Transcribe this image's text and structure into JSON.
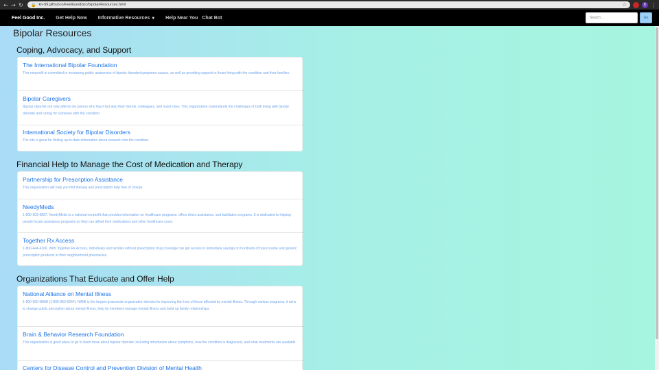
{
  "browser": {
    "back_icon": "back-arrow-icon",
    "forward_icon": "forward-arrow-icon",
    "reload_icon": "reload-icon",
    "url": "kn-99.github.io/FeelGood/src/bipolarResources.html"
  },
  "navbar": {
    "brand": "Feel Good Inc.",
    "links": [
      "Get Help Now",
      "Informative Resources",
      "Help Near You",
      "Chat Bot"
    ],
    "search_placeholder": "Search...",
    "search_button": "Go"
  },
  "page_title": "Bipolar Resources",
  "sections": [
    {
      "heading": "Coping, Advocacy, and Support",
      "items": [
        {
          "title": "The International Bipolar Foundation",
          "desc": "This nonprofit is committed to increasing public awareness of bipolar disorder/symptoms causes, as well as providing support to those living with the condition and their families."
        },
        {
          "title": "Bipolar Caregivers",
          "desc": "Bipolar disorder not only affects the person who has it but also their friends, colleagues, and loved ones. This organization understands the challenges of both living with bipolar disorder and caring for someone with the condition."
        },
        {
          "title": "International Society for Bipolar Disorders",
          "desc": "The site is great for finding up-to-date information about research into the condition."
        }
      ]
    },
    {
      "heading": "Financial Help to Manage the Cost of Medication and Therapy",
      "items": [
        {
          "title": "Partnership for Prescription Assistance",
          "desc": "This organization will help you find therapy and prescription help free of charge."
        },
        {
          "title": "NeedyMeds",
          "desc": "1-800-503-6897. NeedyMeds is a national nonprofit that provides information on healthcare programs, offers direct assistance, and facilitates programs. It is dedicated to helping people locate assistance programs so they can afford their medications and other healthcare costs."
        },
        {
          "title": "Together Rx Access",
          "desc": "1-800-444-4106. With Together Rx Access, individuals and families without prescription drug coverage can get access to immediate savings on hundreds of brand name and generic prescription products at their neighborhood pharmacies."
        }
      ]
    },
    {
      "heading": "Organizations That Educate and Offer Help",
      "items": [
        {
          "title": "National Alliance on Mental Illness",
          "desc": "1-800-950-NAMI (1-800-950-6264). NAMI is the largest grassroots organization devoted to improving the lives of those affected by mental illness. Through various programs, it aims to change public perception about mental illness, help its members manage mental illness and build up family relationships."
        },
        {
          "title": "Brain & Behavior Research Foundation",
          "desc": "This organization is good place to go to learn more about bipolar disorder, including information about symptoms, how the condition is diagnosed, and what treatments are available."
        },
        {
          "title": "Centers for Disease Control and Prevention Division of Mental Health",
          "desc": ""
        }
      ]
    }
  ]
}
